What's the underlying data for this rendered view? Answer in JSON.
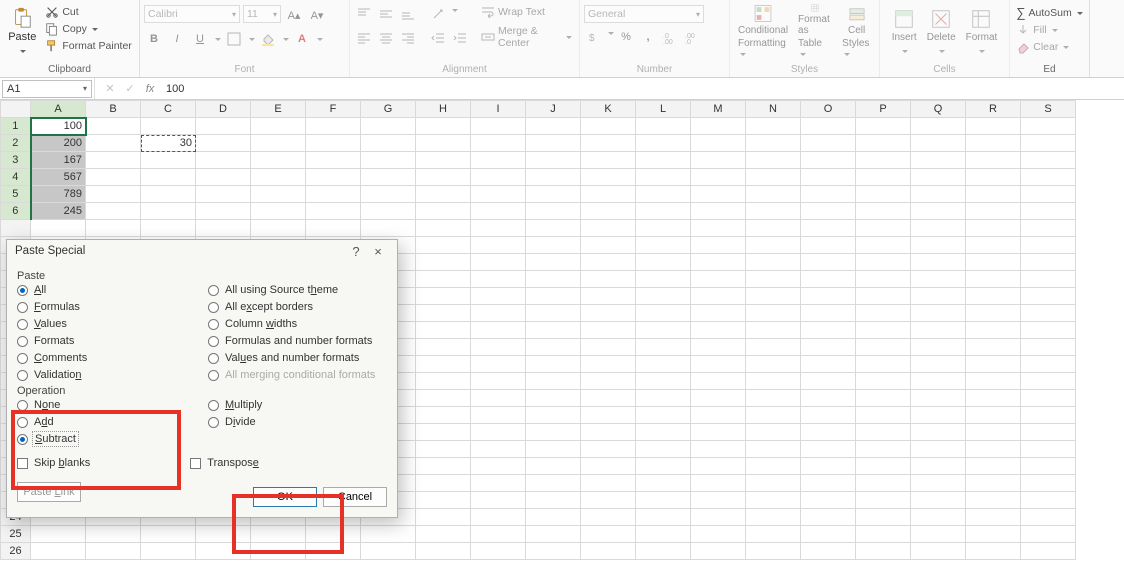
{
  "ribbon": {
    "clipboard": {
      "label": "Clipboard",
      "paste": "Paste",
      "cut": "Cut",
      "copy": "Copy",
      "format_painter": "Format Painter"
    },
    "font": {
      "label": "Font",
      "name": "Calibri",
      "size": "11",
      "bold": "B",
      "italic": "I",
      "underline": "U"
    },
    "alignment": {
      "label": "Alignment",
      "wrap_text": "Wrap Text",
      "merge_center": "Merge & Center"
    },
    "number": {
      "label": "Number",
      "format": "General",
      "pct": "%",
      "comma": ",",
      "dec_inc": ".0",
      "dec_dec": ".00"
    },
    "styles": {
      "label": "Styles",
      "cond": "Conditional",
      "cond2": "Formatting",
      "fmt_as": "Format as",
      "fmt_as2": "Table",
      "cell": "Cell",
      "cell2": "Styles"
    },
    "cells": {
      "label": "Cells",
      "insert": "Insert",
      "delete": "Delete",
      "format": "Format"
    },
    "editing": {
      "label": "Ed",
      "autosum": "AutoSum",
      "fill": "Fill",
      "clear": "Clear"
    }
  },
  "name_box": "A1",
  "formula_bar": "100",
  "columns": [
    "A",
    "B",
    "C",
    "D",
    "E",
    "F",
    "G",
    "H",
    "I",
    "J",
    "K",
    "L",
    "M",
    "N",
    "O",
    "P",
    "Q",
    "R",
    "S"
  ],
  "row_count": 26,
  "cells": {
    "A1": "100",
    "A2": "200",
    "A3": "167",
    "A4": "567",
    "A5": "789",
    "A6": "245",
    "C2": "30"
  },
  "selected_range_rows": [
    1,
    2,
    3,
    4,
    5,
    6
  ],
  "active_cell": "A1",
  "marching_cell": "C2",
  "dialog": {
    "title": "Paste Special",
    "section_paste": "Paste",
    "section_operation": "Operation",
    "paste_options_left": [
      "All",
      "Formulas",
      "Values",
      "Formats",
      "Comments",
      "Validation"
    ],
    "paste_underlines_left": [
      "A",
      "F",
      "V",
      "",
      "C",
      "n"
    ],
    "paste_options_right": [
      "All using Source theme",
      "All except borders",
      "Column widths",
      "Formulas and number formats",
      "Values and number formats",
      "All merging conditional formats"
    ],
    "paste_underlines_right": [
      "h",
      "x",
      "W",
      "",
      "u",
      ""
    ],
    "paste_selected": "All",
    "operation_options_left": [
      "None",
      "Add",
      "Subtract"
    ],
    "operation_underlines_left": [
      "o",
      "d",
      "S"
    ],
    "operation_options_right": [
      "Multiply",
      "Divide"
    ],
    "operation_underlines_right": [
      "M",
      "i"
    ],
    "operation_selected": "Subtract",
    "skip_blanks": "Skip blanks",
    "transpose": "Transpose",
    "paste_link": "Paste Link",
    "ok": "OK",
    "cancel": "Cancel",
    "help": "?",
    "close": "×"
  }
}
